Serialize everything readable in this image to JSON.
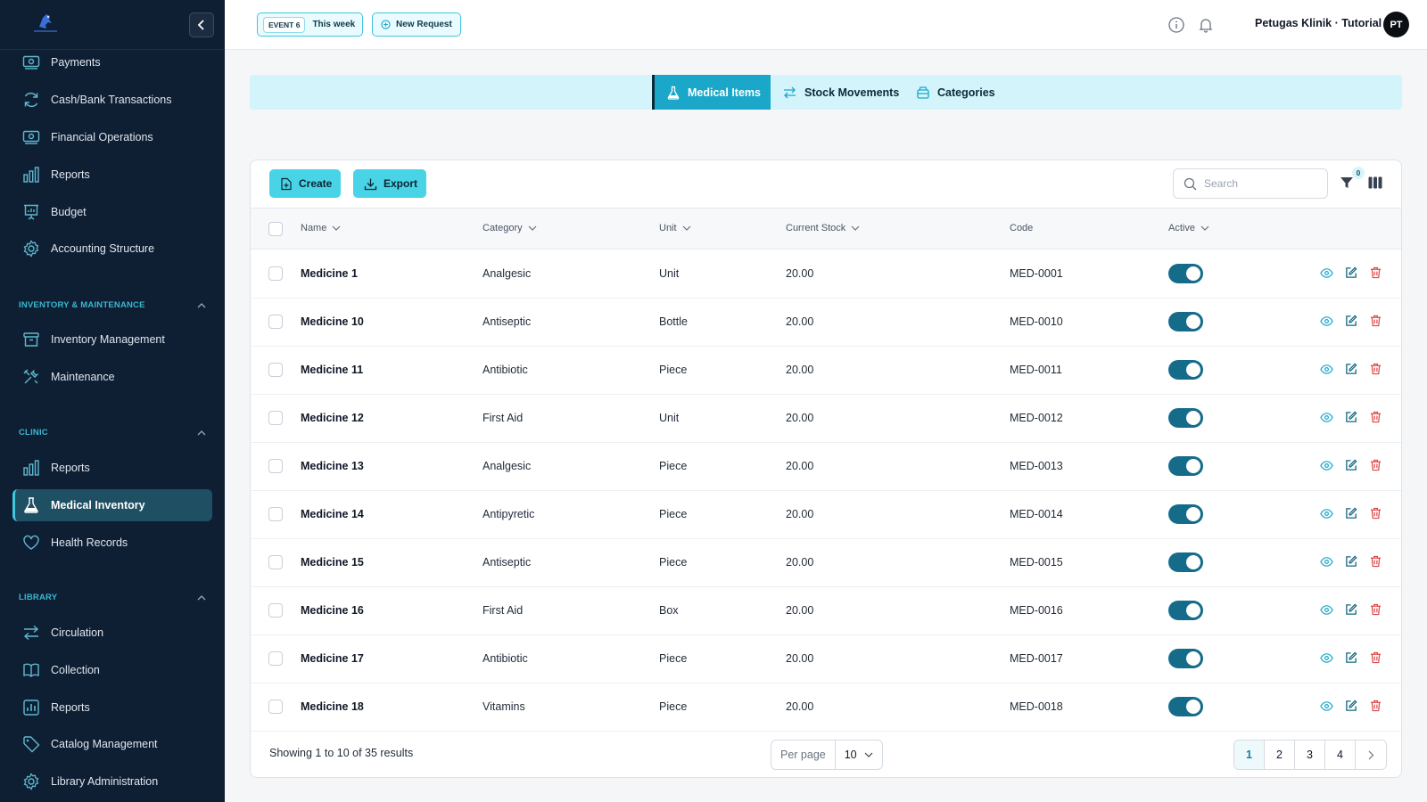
{
  "colors": {
    "sidebar_bg": "#0f1f33",
    "accent": "#48d3e6",
    "active_tab": "#1aa7c9",
    "toggle_on": "#156c8a",
    "delete": "#e04545"
  },
  "sidebar": {
    "logo_icon": "stallion-logo-icon",
    "items_top": [
      {
        "label": "Payments",
        "icon": "payments-icon"
      },
      {
        "label": "Cash/Bank Transactions",
        "icon": "refresh-icon"
      },
      {
        "label": "Financial Operations",
        "icon": "money-icon"
      },
      {
        "label": "Reports",
        "icon": "bar-chart-icon"
      },
      {
        "label": "Budget",
        "icon": "presentation-chart-icon"
      },
      {
        "label": "Accounting Structure",
        "icon": "gear-icon"
      }
    ],
    "sections": [
      {
        "title": "INVENTORY & MAINTENANCE",
        "items": [
          {
            "label": "Inventory Management",
            "icon": "archive-box-icon"
          },
          {
            "label": "Maintenance",
            "icon": "tools-icon"
          }
        ]
      },
      {
        "title": "CLINIC",
        "items": [
          {
            "label": "Reports",
            "icon": "bar-chart-icon"
          },
          {
            "label": "Medical Inventory",
            "icon": "flask-icon",
            "active": true
          },
          {
            "label": "Health Records",
            "icon": "heart-icon"
          }
        ]
      },
      {
        "title": "LIBRARY",
        "items": [
          {
            "label": "Circulation",
            "icon": "arrows-exchange-icon"
          },
          {
            "label": "Collection",
            "icon": "open-book-icon"
          },
          {
            "label": "Reports",
            "icon": "report-chart-icon"
          },
          {
            "label": "Catalog Management",
            "icon": "tag-icon"
          },
          {
            "label": "Library Administration",
            "icon": "gear-icon"
          }
        ]
      }
    ]
  },
  "topbar": {
    "event_code": "EVENT 6",
    "event_period": "This week",
    "new_request": "New Request",
    "user": "Petugas Klinik · Tutorial",
    "avatar_initials": "PT"
  },
  "tabs": [
    {
      "label": "Medical Items",
      "icon": "flask-icon",
      "active": true
    },
    {
      "label": "Stock Movements",
      "icon": "arrows-exchange-icon"
    },
    {
      "label": "Categories",
      "icon": "archive-box-icon"
    }
  ],
  "toolbar": {
    "create": "Create",
    "export": "Export",
    "search_placeholder": "Search",
    "filter_count": "0"
  },
  "table": {
    "columns": [
      "Name",
      "Category",
      "Unit",
      "Current Stock",
      "Code",
      "Active"
    ],
    "rows": [
      {
        "name": "Medicine 1",
        "category": "Analgesic",
        "unit": "Unit",
        "stock": "20.00",
        "code": "MED-0001",
        "active": true
      },
      {
        "name": "Medicine 10",
        "category": "Antiseptic",
        "unit": "Bottle",
        "stock": "20.00",
        "code": "MED-0010",
        "active": true
      },
      {
        "name": "Medicine 11",
        "category": "Antibiotic",
        "unit": "Piece",
        "stock": "20.00",
        "code": "MED-0011",
        "active": true
      },
      {
        "name": "Medicine 12",
        "category": "First Aid",
        "unit": "Unit",
        "stock": "20.00",
        "code": "MED-0012",
        "active": true
      },
      {
        "name": "Medicine 13",
        "category": "Analgesic",
        "unit": "Piece",
        "stock": "20.00",
        "code": "MED-0013",
        "active": true
      },
      {
        "name": "Medicine 14",
        "category": "Antipyretic",
        "unit": "Piece",
        "stock": "20.00",
        "code": "MED-0014",
        "active": true
      },
      {
        "name": "Medicine 15",
        "category": "Antiseptic",
        "unit": "Piece",
        "stock": "20.00",
        "code": "MED-0015",
        "active": true
      },
      {
        "name": "Medicine 16",
        "category": "First Aid",
        "unit": "Box",
        "stock": "20.00",
        "code": "MED-0016",
        "active": true
      },
      {
        "name": "Medicine 17",
        "category": "Antibiotic",
        "unit": "Piece",
        "stock": "20.00",
        "code": "MED-0017",
        "active": true
      },
      {
        "name": "Medicine 18",
        "category": "Vitamins",
        "unit": "Piece",
        "stock": "20.00",
        "code": "MED-0018",
        "active": true
      }
    ]
  },
  "footer": {
    "showing": "Showing 1 to 10 of 35 results",
    "per_page_label": "Per page",
    "per_page_value": "10",
    "pages": [
      "1",
      "2",
      "3",
      "4"
    ],
    "current_page": "1"
  }
}
